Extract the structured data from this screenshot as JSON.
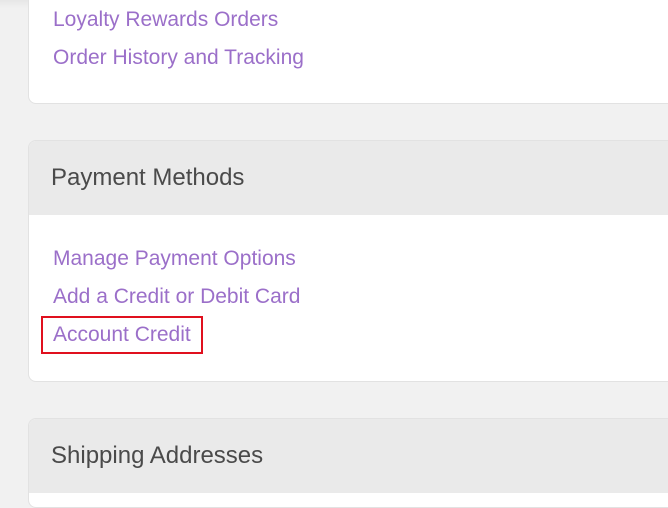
{
  "orders_panel": {
    "links": [
      "Loyalty Rewards Orders",
      "Order History and Tracking"
    ]
  },
  "payment_panel": {
    "title": "Payment Methods",
    "links": [
      "Manage Payment Options",
      "Add a Credit or Debit Card",
      "Account Credit"
    ],
    "highlighted_link_index": 2
  },
  "shipping_panel": {
    "title": "Shipping Addresses"
  },
  "colors": {
    "link": "#9b6fc9",
    "header_bg": "#eaeaea",
    "highlight_border": "#e0101e",
    "page_bg": "#f1f1f1"
  }
}
